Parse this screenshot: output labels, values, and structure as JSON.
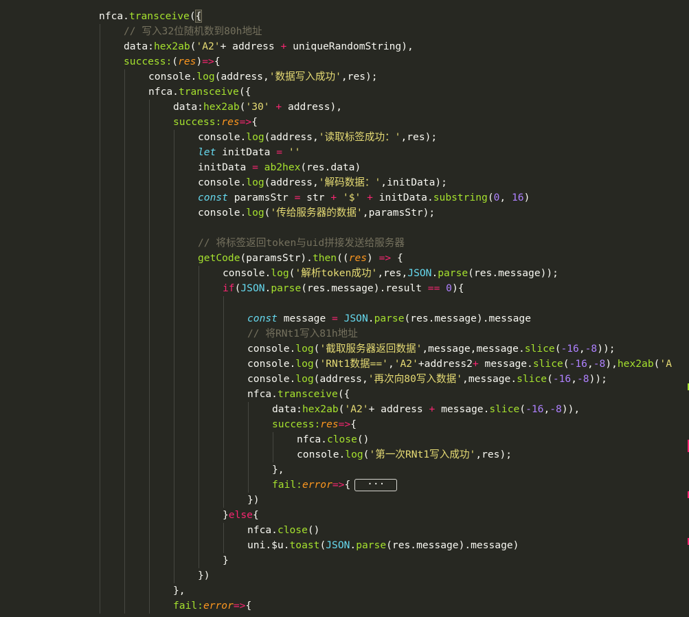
{
  "colors": {
    "background": "#272822",
    "plain": "#f8f8f2",
    "keyword": "#f92672",
    "function": "#a6e22e",
    "string": "#e6db74",
    "number": "#ae81ff",
    "comment": "#75715e",
    "storage": "#66d9ef",
    "param": "#fd971f"
  },
  "code": {
    "lines": [
      {
        "indent": 4,
        "tokens": [
          {
            "t": "nfca.",
            "c": "p"
          },
          {
            "t": "transceive",
            "c": "f"
          },
          {
            "t": "(",
            "c": "p"
          },
          {
            "t": "{",
            "c": "hl"
          }
        ]
      },
      {
        "indent": 5,
        "tokens": [
          {
            "t": "// 写入32位随机数到80h地址",
            "c": "c"
          }
        ]
      },
      {
        "indent": 5,
        "tokens": [
          {
            "t": "data:",
            "c": "p"
          },
          {
            "t": "hex2ab",
            "c": "f"
          },
          {
            "t": "(",
            "c": "p"
          },
          {
            "t": "'A2'",
            "c": "s"
          },
          {
            "t": "+ address ",
            "c": "p"
          },
          {
            "t": "+",
            "c": "k"
          },
          {
            "t": " uniqueRandomString),",
            "c": "p"
          }
        ]
      },
      {
        "indent": 5,
        "tokens": [
          {
            "t": "success:",
            "c": "f"
          },
          {
            "t": "(",
            "c": "p"
          },
          {
            "t": "res",
            "c": "o"
          },
          {
            "t": ")",
            "c": "p"
          },
          {
            "t": "=>",
            "c": "k"
          },
          {
            "t": "{",
            "c": "p"
          }
        ]
      },
      {
        "indent": 6,
        "tokens": [
          {
            "t": "console.",
            "c": "p"
          },
          {
            "t": "log",
            "c": "f"
          },
          {
            "t": "(address,",
            "c": "p"
          },
          {
            "t": "'数据写入成功'",
            "c": "s"
          },
          {
            "t": ",res);",
            "c": "p"
          }
        ]
      },
      {
        "indent": 6,
        "tokens": [
          {
            "t": "nfca.",
            "c": "p"
          },
          {
            "t": "transceive",
            "c": "f"
          },
          {
            "t": "({",
            "c": "p"
          }
        ]
      },
      {
        "indent": 7,
        "tokens": [
          {
            "t": "data:",
            "c": "p"
          },
          {
            "t": "hex2ab",
            "c": "f"
          },
          {
            "t": "(",
            "c": "p"
          },
          {
            "t": "'30'",
            "c": "s"
          },
          {
            "t": " ",
            "c": "p"
          },
          {
            "t": "+",
            "c": "k"
          },
          {
            "t": " address),",
            "c": "p"
          }
        ]
      },
      {
        "indent": 7,
        "tokens": [
          {
            "t": "success:",
            "c": "f"
          },
          {
            "t": "res",
            "c": "o"
          },
          {
            "t": "=>",
            "c": "k"
          },
          {
            "t": "{",
            "c": "p"
          }
        ]
      },
      {
        "indent": 8,
        "tokens": [
          {
            "t": "console.",
            "c": "p"
          },
          {
            "t": "log",
            "c": "f"
          },
          {
            "t": "(address,",
            "c": "p"
          },
          {
            "t": "'读取标签成功：'",
            "c": "s"
          },
          {
            "t": ",res);",
            "c": "p"
          }
        ]
      },
      {
        "indent": 8,
        "tokens": [
          {
            "t": "let",
            "c": "i"
          },
          {
            "t": " initData ",
            "c": "p"
          },
          {
            "t": "=",
            "c": "k"
          },
          {
            "t": " ",
            "c": "p"
          },
          {
            "t": "''",
            "c": "s"
          }
        ]
      },
      {
        "indent": 8,
        "tokens": [
          {
            "t": "initData ",
            "c": "p"
          },
          {
            "t": "=",
            "c": "k"
          },
          {
            "t": " ",
            "c": "p"
          },
          {
            "t": "ab2hex",
            "c": "f"
          },
          {
            "t": "(res.data)",
            "c": "p"
          }
        ]
      },
      {
        "indent": 8,
        "tokens": [
          {
            "t": "console.",
            "c": "p"
          },
          {
            "t": "log",
            "c": "f"
          },
          {
            "t": "(address,",
            "c": "p"
          },
          {
            "t": "'解码数据：'",
            "c": "s"
          },
          {
            "t": ",initData);",
            "c": "p"
          }
        ]
      },
      {
        "indent": 8,
        "tokens": [
          {
            "t": "const",
            "c": "i"
          },
          {
            "t": " paramsStr ",
            "c": "p"
          },
          {
            "t": "=",
            "c": "k"
          },
          {
            "t": " str ",
            "c": "p"
          },
          {
            "t": "+",
            "c": "k"
          },
          {
            "t": " ",
            "c": "p"
          },
          {
            "t": "'$'",
            "c": "s"
          },
          {
            "t": " ",
            "c": "p"
          },
          {
            "t": "+",
            "c": "k"
          },
          {
            "t": " initData.",
            "c": "p"
          },
          {
            "t": "substring",
            "c": "f"
          },
          {
            "t": "(",
            "c": "p"
          },
          {
            "t": "0",
            "c": "n"
          },
          {
            "t": ", ",
            "c": "p"
          },
          {
            "t": "16",
            "c": "n"
          },
          {
            "t": ")",
            "c": "p"
          }
        ]
      },
      {
        "indent": 8,
        "tokens": [
          {
            "t": "console.",
            "c": "p"
          },
          {
            "t": "log",
            "c": "f"
          },
          {
            "t": "(",
            "c": "p"
          },
          {
            "t": "'传给服务器的数据'",
            "c": "s"
          },
          {
            "t": ",paramsStr);",
            "c": "p"
          }
        ]
      },
      {
        "indent": 8,
        "tokens": []
      },
      {
        "indent": 8,
        "tokens": [
          {
            "t": "// 将标签返回token与uid拼接发送给服务器",
            "c": "c"
          }
        ]
      },
      {
        "indent": 8,
        "tokens": [
          {
            "t": "getCode",
            "c": "f"
          },
          {
            "t": "(paramsStr).",
            "c": "p"
          },
          {
            "t": "then",
            "c": "f"
          },
          {
            "t": "((",
            "c": "p"
          },
          {
            "t": "res",
            "c": "o"
          },
          {
            "t": ") ",
            "c": "p"
          },
          {
            "t": "=>",
            "c": "k"
          },
          {
            "t": " {",
            "c": "p"
          }
        ]
      },
      {
        "indent": 9,
        "tokens": [
          {
            "t": "console.",
            "c": "p"
          },
          {
            "t": "log",
            "c": "f"
          },
          {
            "t": "(",
            "c": "p"
          },
          {
            "t": "'解析token成功'",
            "c": "s"
          },
          {
            "t": ",res,",
            "c": "p"
          },
          {
            "t": "JSON",
            "c": "b"
          },
          {
            "t": ".",
            "c": "p"
          },
          {
            "t": "parse",
            "c": "f"
          },
          {
            "t": "(res.message));",
            "c": "p"
          }
        ]
      },
      {
        "indent": 9,
        "tokens": [
          {
            "t": "if",
            "c": "k"
          },
          {
            "t": "(",
            "c": "p"
          },
          {
            "t": "JSON",
            "c": "b"
          },
          {
            "t": ".",
            "c": "p"
          },
          {
            "t": "parse",
            "c": "f"
          },
          {
            "t": "(res.message).result ",
            "c": "p"
          },
          {
            "t": "==",
            "c": "k"
          },
          {
            "t": " ",
            "c": "p"
          },
          {
            "t": "0",
            "c": "n"
          },
          {
            "t": "){",
            "c": "p"
          }
        ]
      },
      {
        "indent": 10,
        "tokens": []
      },
      {
        "indent": 10,
        "tokens": [
          {
            "t": "const",
            "c": "i"
          },
          {
            "t": " message ",
            "c": "p"
          },
          {
            "t": "=",
            "c": "k"
          },
          {
            "t": " ",
            "c": "p"
          },
          {
            "t": "JSON",
            "c": "b"
          },
          {
            "t": ".",
            "c": "p"
          },
          {
            "t": "parse",
            "c": "f"
          },
          {
            "t": "(res.message).message",
            "c": "p"
          }
        ]
      },
      {
        "indent": 10,
        "tokens": [
          {
            "t": "// 将RNt1写入81h地址",
            "c": "c"
          }
        ]
      },
      {
        "indent": 10,
        "tokens": [
          {
            "t": "console.",
            "c": "p"
          },
          {
            "t": "log",
            "c": "f"
          },
          {
            "t": "(",
            "c": "p"
          },
          {
            "t": "'截取服务器返回数据'",
            "c": "s"
          },
          {
            "t": ",message,message.",
            "c": "p"
          },
          {
            "t": "slice",
            "c": "f"
          },
          {
            "t": "(",
            "c": "p"
          },
          {
            "t": "-16",
            "c": "n"
          },
          {
            "t": ",",
            "c": "p"
          },
          {
            "t": "-8",
            "c": "n"
          },
          {
            "t": "));",
            "c": "p"
          }
        ]
      },
      {
        "indent": 10,
        "tokens": [
          {
            "t": "console.",
            "c": "p"
          },
          {
            "t": "log",
            "c": "f"
          },
          {
            "t": "(",
            "c": "p"
          },
          {
            "t": "'RNt1数据=='",
            "c": "s"
          },
          {
            "t": ",",
            "c": "p"
          },
          {
            "t": "'A2'",
            "c": "s"
          },
          {
            "t": "+address2",
            "c": "p"
          },
          {
            "t": "+",
            "c": "k"
          },
          {
            "t": " message.",
            "c": "p"
          },
          {
            "t": "slice",
            "c": "f"
          },
          {
            "t": "(",
            "c": "p"
          },
          {
            "t": "-16",
            "c": "n"
          },
          {
            "t": ",",
            "c": "p"
          },
          {
            "t": "-8",
            "c": "n"
          },
          {
            "t": "),",
            "c": "p"
          },
          {
            "t": "hex2ab",
            "c": "f"
          },
          {
            "t": "(",
            "c": "p"
          },
          {
            "t": "'A",
            "c": "s"
          }
        ]
      },
      {
        "indent": 10,
        "tokens": [
          {
            "t": "console.",
            "c": "p"
          },
          {
            "t": "log",
            "c": "f"
          },
          {
            "t": "(address,",
            "c": "p"
          },
          {
            "t": "'再次向80写入数据'",
            "c": "s"
          },
          {
            "t": ",message.",
            "c": "p"
          },
          {
            "t": "slice",
            "c": "f"
          },
          {
            "t": "(",
            "c": "p"
          },
          {
            "t": "-16",
            "c": "n"
          },
          {
            "t": ",",
            "c": "p"
          },
          {
            "t": "-8",
            "c": "n"
          },
          {
            "t": "));",
            "c": "p"
          }
        ]
      },
      {
        "indent": 10,
        "tokens": [
          {
            "t": "nfca.",
            "c": "p"
          },
          {
            "t": "transceive",
            "c": "f"
          },
          {
            "t": "({",
            "c": "p"
          }
        ]
      },
      {
        "indent": 11,
        "tokens": [
          {
            "t": "data:",
            "c": "p"
          },
          {
            "t": "hex2ab",
            "c": "f"
          },
          {
            "t": "(",
            "c": "p"
          },
          {
            "t": "'A2'",
            "c": "s"
          },
          {
            "t": "+ address ",
            "c": "p"
          },
          {
            "t": "+",
            "c": "k"
          },
          {
            "t": " message.",
            "c": "p"
          },
          {
            "t": "slice",
            "c": "f"
          },
          {
            "t": "(",
            "c": "p"
          },
          {
            "t": "-16",
            "c": "n"
          },
          {
            "t": ",",
            "c": "p"
          },
          {
            "t": "-8",
            "c": "n"
          },
          {
            "t": ")),",
            "c": "p"
          }
        ]
      },
      {
        "indent": 11,
        "tokens": [
          {
            "t": "success:",
            "c": "f"
          },
          {
            "t": "res",
            "c": "o"
          },
          {
            "t": "=>",
            "c": "k"
          },
          {
            "t": "{",
            "c": "p"
          }
        ]
      },
      {
        "indent": 12,
        "tokens": [
          {
            "t": "nfca.",
            "c": "p"
          },
          {
            "t": "close",
            "c": "f"
          },
          {
            "t": "()",
            "c": "p"
          }
        ]
      },
      {
        "indent": 12,
        "tokens": [
          {
            "t": "console.",
            "c": "p"
          },
          {
            "t": "log",
            "c": "f"
          },
          {
            "t": "(",
            "c": "p"
          },
          {
            "t": "'第一次RNt1写入成功'",
            "c": "s"
          },
          {
            "t": ",res);",
            "c": "p"
          }
        ]
      },
      {
        "indent": 11,
        "tokens": [
          {
            "t": "},",
            "c": "p"
          }
        ]
      },
      {
        "indent": 11,
        "tokens": [
          {
            "t": "fail:",
            "c": "f"
          },
          {
            "t": "error",
            "c": "o"
          },
          {
            "t": "=>",
            "c": "k"
          },
          {
            "t": "{",
            "c": "p"
          },
          {
            "t": "···",
            "c": "box"
          }
        ]
      },
      {
        "indent": 10,
        "tokens": [
          {
            "t": "})",
            "c": "p"
          }
        ]
      },
      {
        "indent": 9,
        "tokens": [
          {
            "t": "}",
            "c": "p"
          },
          {
            "t": "else",
            "c": "k"
          },
          {
            "t": "{",
            "c": "p"
          }
        ]
      },
      {
        "indent": 10,
        "tokens": [
          {
            "t": "nfca.",
            "c": "p"
          },
          {
            "t": "close",
            "c": "f"
          },
          {
            "t": "()",
            "c": "p"
          }
        ]
      },
      {
        "indent": 10,
        "tokens": [
          {
            "t": "uni.$u.",
            "c": "p"
          },
          {
            "t": "toast",
            "c": "f"
          },
          {
            "t": "(",
            "c": "p"
          },
          {
            "t": "JSON",
            "c": "b"
          },
          {
            "t": ".",
            "c": "p"
          },
          {
            "t": "parse",
            "c": "f"
          },
          {
            "t": "(res.message).message)",
            "c": "p"
          }
        ]
      },
      {
        "indent": 9,
        "tokens": [
          {
            "t": "}",
            "c": "p"
          }
        ]
      },
      {
        "indent": 8,
        "tokens": [
          {
            "t": "})",
            "c": "p"
          }
        ]
      },
      {
        "indent": 7,
        "tokens": [
          {
            "t": "},",
            "c": "p"
          }
        ]
      },
      {
        "indent": 7,
        "tokens": [
          {
            "t": "fail:",
            "c": "f"
          },
          {
            "t": "error",
            "c": "o"
          },
          {
            "t": "=>",
            "c": "k"
          },
          {
            "t": "{",
            "c": "p"
          }
        ]
      }
    ]
  },
  "scrollbar_markers": [
    {
      "color": "#a6e22e"
    },
    {
      "color": "#f92672"
    },
    {
      "color": "#f92672"
    },
    {
      "color": "#f92672"
    },
    {
      "color": "#f92672"
    }
  ]
}
